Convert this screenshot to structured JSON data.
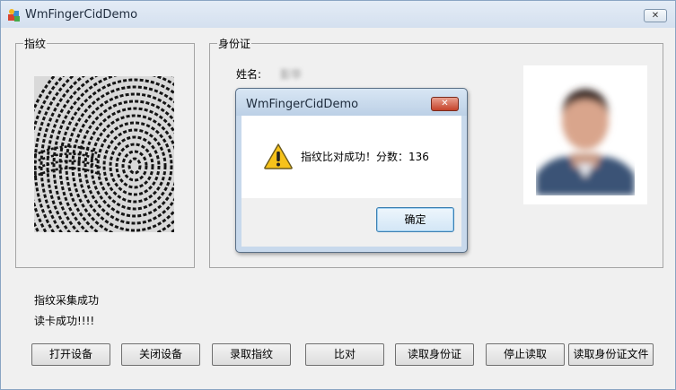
{
  "window": {
    "title": "WmFingerCidDemo",
    "close_glyph": "✕"
  },
  "fingerprint_group": {
    "legend": "指纹"
  },
  "id_group": {
    "legend": "身份证",
    "name_label": "姓名:",
    "name_value": "彭华"
  },
  "status": {
    "line1": "指纹采集成功",
    "line2": "读卡成功!!!!"
  },
  "buttons": [
    {
      "label": "打开设备"
    },
    {
      "label": "关闭设备"
    },
    {
      "label": "录取指纹"
    },
    {
      "label": "比对"
    },
    {
      "label": "读取身份证"
    },
    {
      "label": "停止读取"
    },
    {
      "label": "读取身份证文件"
    }
  ],
  "dialog": {
    "title": "WmFingerCidDemo",
    "close_glyph": "✕",
    "message": "指纹比对成功！分数：136",
    "ok_label": "确定",
    "icon": "warning-icon"
  },
  "colors": {
    "window_bg": "#f0f0f0",
    "titlebar": "#d4e0ef",
    "dialog_close": "#c5422a",
    "warning_yellow": "#f6c21b"
  }
}
